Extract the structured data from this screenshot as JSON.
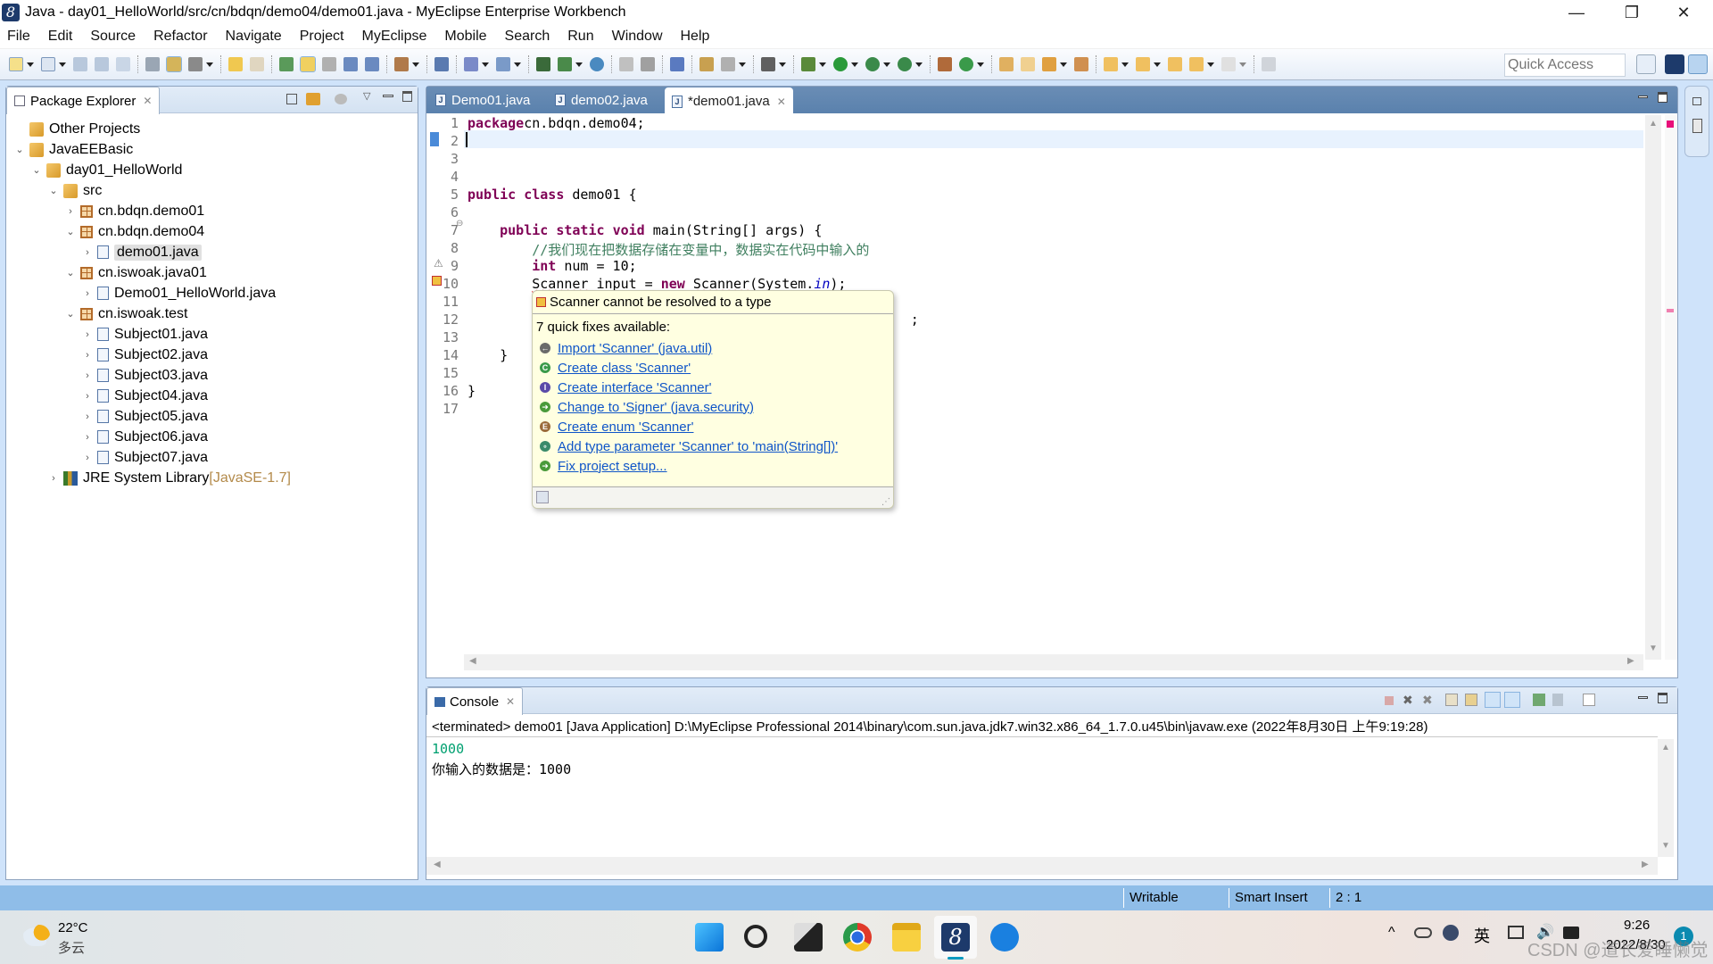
{
  "window": {
    "title": "Java - day01_HelloWorld/src/cn/bdqn/demo04/demo01.java - MyEclipse Enterprise Workbench",
    "app_icon_glyph": "8",
    "minimize_glyph": "—",
    "restore_glyph": "❐",
    "close_glyph": "✕"
  },
  "menu": [
    "File",
    "Edit",
    "Source",
    "Refactor",
    "Navigate",
    "Project",
    "MyEclipse",
    "Mobile",
    "Search",
    "Run",
    "Window",
    "Help"
  ],
  "toolbar": {
    "quick_access_placeholder": "Quick Access"
  },
  "package_explorer": {
    "title": "Package Explorer",
    "close_glyph": "✕",
    "tree": [
      {
        "label": "Other Projects",
        "level": 0,
        "twisty": "",
        "icon": "working-set"
      },
      {
        "label": "JavaEEBasic",
        "level": 0,
        "twisty": "⌄",
        "icon": "working-set"
      },
      {
        "label": "day01_HelloWorld",
        "level": 1,
        "twisty": "⌄",
        "icon": "java-project"
      },
      {
        "label": "src",
        "level": 2,
        "twisty": "⌄",
        "icon": "source-folder"
      },
      {
        "label": "cn.bdqn.demo01",
        "level": 3,
        "twisty": "›",
        "icon": "package"
      },
      {
        "label": "cn.bdqn.demo04",
        "level": 3,
        "twisty": "⌄",
        "icon": "package"
      },
      {
        "label": "demo01.java",
        "level": 4,
        "twisty": "›",
        "icon": "java-file",
        "selected": true
      },
      {
        "label": "cn.iswoak.java01",
        "level": 3,
        "twisty": "⌄",
        "icon": "package"
      },
      {
        "label": "Demo01_HelloWorld.java",
        "level": 4,
        "twisty": "›",
        "icon": "java-file"
      },
      {
        "label": "cn.iswoak.test",
        "level": 3,
        "twisty": "⌄",
        "icon": "package"
      },
      {
        "label": "Subject01.java",
        "level": 4,
        "twisty": "›",
        "icon": "java-file"
      },
      {
        "label": "Subject02.java",
        "level": 4,
        "twisty": "›",
        "icon": "java-file"
      },
      {
        "label": "Subject03.java",
        "level": 4,
        "twisty": "›",
        "icon": "java-file"
      },
      {
        "label": "Subject04.java",
        "level": 4,
        "twisty": "›",
        "icon": "java-file"
      },
      {
        "label": "Subject05.java",
        "level": 4,
        "twisty": "›",
        "icon": "java-file"
      },
      {
        "label": "Subject06.java",
        "level": 4,
        "twisty": "›",
        "icon": "java-file"
      },
      {
        "label": "Subject07.java",
        "level": 4,
        "twisty": "›",
        "icon": "java-file"
      },
      {
        "label": "JRE System Library",
        "level": 2,
        "twisty": "›",
        "icon": "library",
        "decoration": "[JavaSE-1.7]"
      }
    ]
  },
  "editor": {
    "tabs": [
      {
        "label": "Demo01.java",
        "active": false
      },
      {
        "label": "demo02.java",
        "active": false
      },
      {
        "label": "*demo01.java",
        "active": true
      }
    ],
    "close_glyph": "✕",
    "lines": [
      {
        "n": "1",
        "parts": [
          [
            "kw",
            "package"
          ],
          [
            "",
            "cn.bdqn.demo04;"
          ]
        ]
      },
      {
        "n": "2",
        "parts": []
      },
      {
        "n": "3",
        "parts": []
      },
      {
        "n": "4",
        "parts": []
      },
      {
        "n": "5",
        "parts": [
          [
            "kw",
            "public"
          ],
          [
            "",
            " "
          ],
          [
            "kw",
            "class"
          ],
          [
            "",
            " demo01 {"
          ]
        ]
      },
      {
        "n": "6",
        "parts": []
      },
      {
        "n": "7",
        "parts": [
          [
            "",
            "    "
          ],
          [
            "kw",
            "public"
          ],
          [
            "",
            " "
          ],
          [
            "kw",
            "static"
          ],
          [
            "",
            " "
          ],
          [
            "kw",
            "void"
          ],
          [
            "",
            " main(String[] args) {"
          ]
        ]
      },
      {
        "n": "8",
        "parts": [
          [
            "",
            "        "
          ],
          [
            "cm",
            "//我们现在把数据存储在变量中，数据实在代码中输入的"
          ]
        ]
      },
      {
        "n": "9",
        "parts": [
          [
            "",
            "        "
          ],
          [
            "kw",
            "int"
          ],
          [
            "",
            " num = 10;"
          ]
        ]
      },
      {
        "n": "10",
        "parts": [
          [
            "",
            "        "
          ],
          [
            "err",
            "Scanner"
          ],
          [
            "",
            " input = "
          ],
          [
            "kw",
            "new"
          ],
          [
            "",
            " "
          ],
          [
            "err",
            "Scanner"
          ],
          [
            "",
            "(System."
          ],
          [
            "fld",
            "in"
          ],
          [
            "",
            ");"
          ]
        ]
      },
      {
        "n": "11",
        "parts": []
      },
      {
        "n": "12",
        "parts": [
          [
            "",
            "                                                       ;"
          ]
        ]
      },
      {
        "n": "13",
        "parts": []
      },
      {
        "n": "14",
        "parts": [
          [
            "",
            "    }"
          ]
        ]
      },
      {
        "n": "15",
        "parts": []
      },
      {
        "n": "16",
        "parts": [
          [
            "",
            "}"
          ]
        ]
      },
      {
        "n": "17",
        "parts": []
      }
    ],
    "fold_marker_glyph": "⊖",
    "warning_glyph": "⚠"
  },
  "quickfix": {
    "problem": "Scanner cannot be resolved to a type",
    "count_text": "7 quick fixes available:",
    "fixes": [
      {
        "label": "Import 'Scanner' (java.util)",
        "icon": "import-icon",
        "color": "#6a6a6a",
        "glyph": "←"
      },
      {
        "label": "Create class 'Scanner'",
        "icon": "class-icon",
        "color": "#3a9a4a",
        "glyph": "C"
      },
      {
        "label": "Create interface 'Scanner'",
        "icon": "interface-icon",
        "color": "#5a4aa8",
        "glyph": "I"
      },
      {
        "label": "Change to 'Signer' (java.security)",
        "icon": "change-icon",
        "color": "#4a9a3a",
        "glyph": "➜"
      },
      {
        "label": "Create enum 'Scanner'",
        "icon": "enum-icon",
        "color": "#9a6a3a",
        "glyph": "E"
      },
      {
        "label": "Add type parameter 'Scanner' to 'main(String[])'",
        "icon": "type-param-icon",
        "color": "#3a8a6a",
        "glyph": "∘"
      },
      {
        "label": "Fix project setup...",
        "icon": "fix-setup-icon",
        "color": "#4a9a3a",
        "glyph": "➜"
      }
    ]
  },
  "console": {
    "title": "Console",
    "close_glyph": "✕",
    "header": "<terminated> demo01 [Java Application] D:\\MyEclipse Professional 2014\\binary\\com.sun.java.jdk7.win32.x86_64_1.7.0.u45\\bin\\javaw.exe (2022年8月30日 上午9:19:28)",
    "lines": [
      {
        "text": "1000",
        "color": "#00a070"
      },
      {
        "text": "你输入的数据是：1000",
        "color": "#000000"
      }
    ]
  },
  "statusbar": {
    "writable": "Writable",
    "insert_mode": "Smart Insert",
    "position": "2 : 1"
  },
  "taskbar": {
    "weather_temp": "22°C",
    "weather_desc": "多云",
    "ime": "英",
    "time": "9:26",
    "date_partial": "2022/8/30",
    "notification_count": "1",
    "watermark": "CSDN @道长爱睡懒觉"
  }
}
